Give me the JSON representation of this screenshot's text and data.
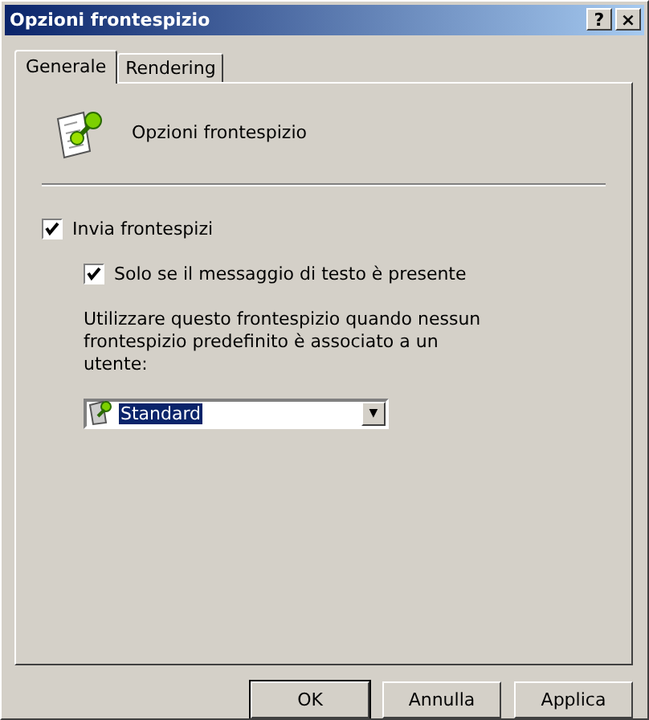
{
  "window": {
    "title": "Opzioni frontespizio",
    "help_button": "?",
    "close_button": "×"
  },
  "tabs": [
    {
      "label": "Generale",
      "selected": true
    },
    {
      "label": "Rendering",
      "selected": false
    }
  ],
  "header": {
    "title": "Opzioni frontespizio"
  },
  "send_cover": {
    "label": "Invia frontespizi",
    "checked": true
  },
  "only_text": {
    "label": "Solo se il messaggio di testo è presente",
    "checked": true
  },
  "description": "Utilizzare questo frontespizio quando nessun frontespizio predefinito è associato a un utente:",
  "cover_select": {
    "value": "Standard",
    "arrow": "▼"
  },
  "buttons": [
    "OK",
    "Annulla",
    "Applica"
  ]
}
